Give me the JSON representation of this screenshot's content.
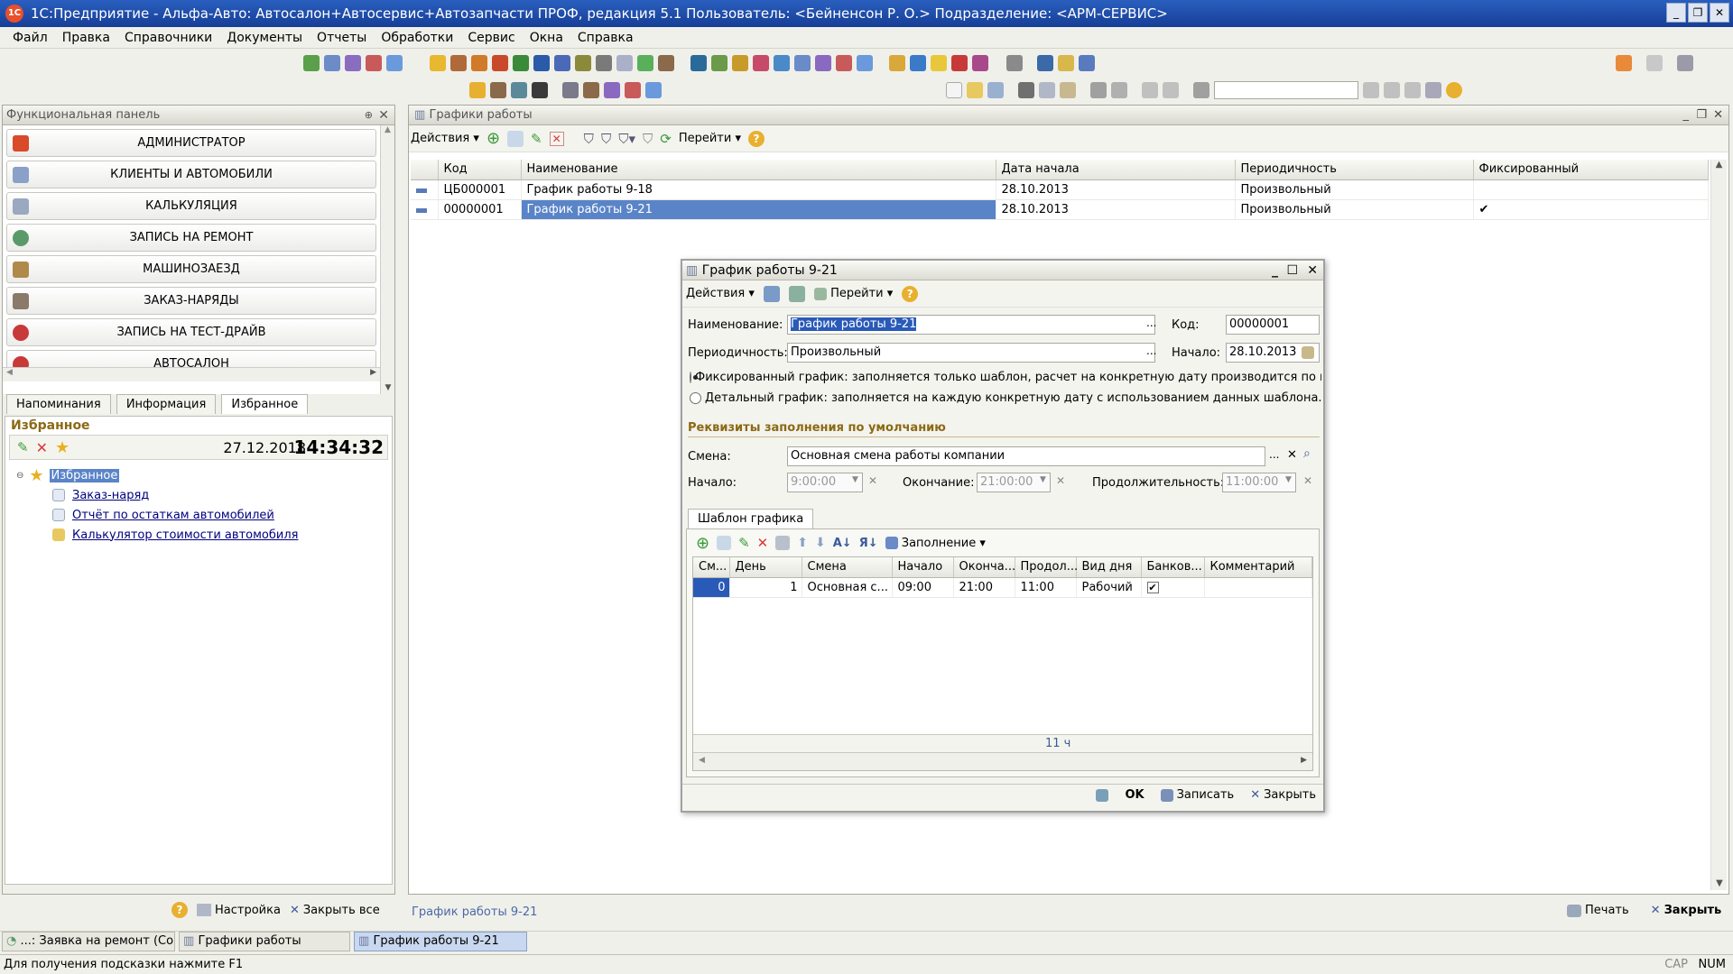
{
  "window": {
    "title": "1С:Предприятие - Альфа-Авто: Автосалон+Автосервис+Автозапчасти ПРОФ, редакция 5.1   Пользователь: <Бейненсон Р. О.>   Подразделение: <АРМ-СЕРВИС>"
  },
  "menu": [
    "Файл",
    "Правка",
    "Справочники",
    "Документы",
    "Отчеты",
    "Обработки",
    "Сервис",
    "Окна",
    "Справка"
  ],
  "funcpanel": {
    "title": "Функциональная панель",
    "items": [
      "АДМИНИСТРАТОР",
      "КЛИЕНТЫ И АВТОМОБИЛИ",
      "КАЛЬКУЛЯЦИЯ",
      "ЗАПИСЬ НА РЕМОНТ",
      "МАШИНОЗАЕЗД",
      "ЗАКАЗ-НАРЯДЫ",
      "ЗАПИСЬ НА ТЕСТ-ДРАЙВ",
      "АВТОСАЛОН"
    ],
    "tabs": [
      "Напоминания",
      "Информация",
      "Избранное"
    ],
    "fav_title": "Избранное",
    "date": "27.12.2018",
    "time": "14:34:32",
    "tree_root": "Избранное",
    "tree_items": [
      "Заказ-наряд",
      "Отчёт по остаткам автомобилей",
      "Калькулятор стоимости автомобиля"
    ],
    "bottom": {
      "settings": "Настройка",
      "close_all": "Закрыть все"
    }
  },
  "list": {
    "title": "Графики работы",
    "actions": "Действия",
    "goto": "Перейти",
    "columns": [
      "Код",
      "Наименование",
      "Дата начала",
      "Периодичность",
      "Фиксированный"
    ],
    "rows": [
      {
        "code": "ЦБ000001",
        "name": "График работы 9-18",
        "date": "28.10.2013",
        "period": "Произвольный",
        "fixed": ""
      },
      {
        "code": "00000001",
        "name": "График работы 9-21",
        "date": "28.10.2013",
        "period": "Произвольный",
        "fixed": "✔"
      }
    ],
    "footer_link": "График работы 9-21",
    "print": "Печать",
    "close": "Закрыть"
  },
  "dialog": {
    "title": "График работы 9-21",
    "actions": "Действия",
    "goto": "Перейти",
    "name_label": "Наименование:",
    "name_value": "График работы 9-21",
    "code_label": "Код:",
    "code_value": "00000001",
    "period_label": "Периодичность:",
    "period_value": "Произвольный",
    "start_label": "Начало:",
    "start_value": "28.10.2013",
    "radio_fixed": "Фиксированный график: заполняется только шаблон, расчет на конкретную дату производится по не...",
    "radio_detail": "Детальный график: заполняется на каждую конкретную дату с использованием данных шаблона.",
    "section_title": "Реквизиты заполнения по умолчанию",
    "shift_label": "Смена:",
    "shift_value": "Основная смена работы компании",
    "begin_label": "Начало:",
    "begin_value": "9:00:00",
    "end_label": "Окончание:",
    "end_value": "21:00:00",
    "duration_label": "Продолжительность:",
    "duration_value": "11:00:00",
    "template_tab": "Шаблон графика",
    "fill_label": "Заполнение",
    "grid_columns": [
      "См...",
      "День",
      "Смена",
      "Начало",
      "Оконча...",
      "Продол...",
      "Вид дня",
      "Банков...",
      "Комментарий"
    ],
    "grid_row": {
      "shift_no": "0",
      "day": "1",
      "shift": "Основная с...",
      "start": "09:00",
      "end": "21:00",
      "duration": "11:00",
      "day_type": "Рабочий",
      "bank": "✔",
      "comment": ""
    },
    "total": "11 ч",
    "ok": "OK",
    "save": "Записать",
    "close": "Закрыть"
  },
  "taskbar": [
    "...: Заявка на ремонт (Со...",
    "Графики работы",
    "График работы 9-21"
  ],
  "status": {
    "hint": "Для получения подсказки нажмите F1",
    "cap": "CAP",
    "num": "NUM"
  },
  "colors": {
    "titlebar": "#1e4fa8",
    "selection": "#5a84c8",
    "accent_header": "#8b6914"
  }
}
